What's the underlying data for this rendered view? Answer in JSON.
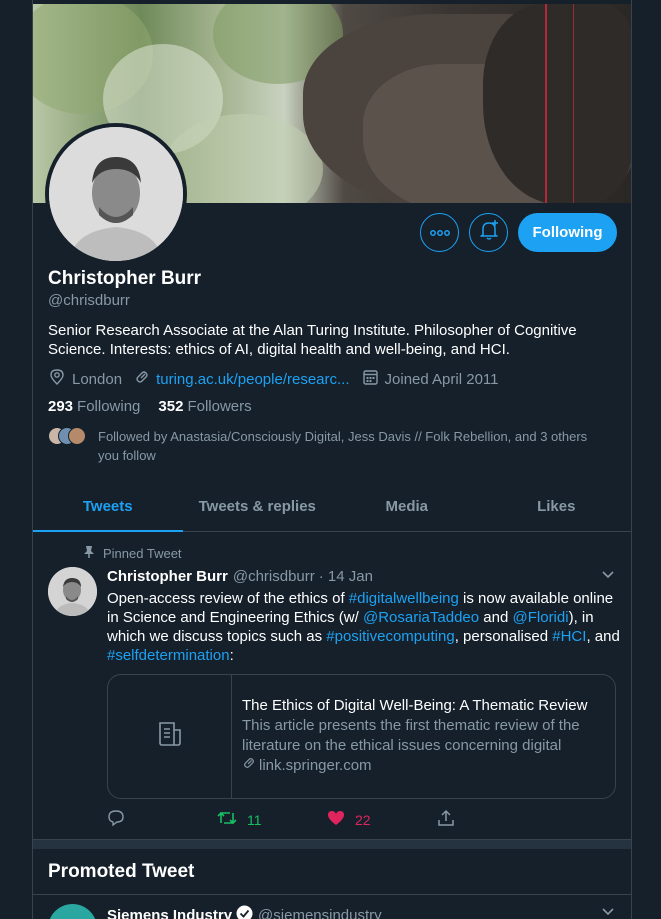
{
  "colors": {
    "background": "#15202b",
    "accent": "#1da1f2",
    "muted": "#8899a6",
    "retweet": "#17bf63",
    "like": "#e0245e",
    "border": "#38444d"
  },
  "profile": {
    "name": "Christopher Burr",
    "handle": "@chrisdburr",
    "bio": "Senior Research Associate at the Alan Turing Institute. Philosopher of Cognitive Science. Interests: ethics of AI, digital health and well-being, and HCI.",
    "location": "London",
    "website": "turing.ac.uk/people/researc...",
    "joined": "Joined April 2011",
    "following_count": "293",
    "following_label": "Following",
    "followers_count": "352",
    "followers_label": "Followers",
    "followed_by": "Followed by Anastasia/Consciously Digital, Jess Davis // Folk Rebellion, and 3 others you follow",
    "follow_button": "Following",
    "icons": {
      "more": "more-icon",
      "notifications": "bell-plus-icon",
      "location": "location-pin-icon",
      "link": "link-icon",
      "calendar": "calendar-icon"
    }
  },
  "tabs": [
    {
      "label": "Tweets",
      "active": true
    },
    {
      "label": "Tweets & replies",
      "active": false
    },
    {
      "label": "Media",
      "active": false
    },
    {
      "label": "Likes",
      "active": false
    }
  ],
  "pinned_tweet": {
    "pinned_label": "Pinned Tweet",
    "author": "Christopher Burr",
    "handle": "@chrisdburr",
    "date": "· 14 Jan",
    "text": {
      "t1": "Open-access review of the ethics of ",
      "tag1": "#digitalwellbeing",
      "t2": " is now available online in Science and Engineering Ethics (w/ ",
      "mention1": "@RosariaTaddeo",
      "t3": " and ",
      "mention2": "@Floridi",
      "t4": "), in which we discuss topics such as ",
      "tag2": "#positivecomputing",
      "t5": ", personalised ",
      "tag3": "#HCI",
      "t6": ", and ",
      "tag4": "#selfdetermination",
      "t7": ":"
    },
    "card": {
      "title": "The Ethics of Digital Well-Being: A Thematic Review",
      "description": "This article presents the first thematic review of the literature on the ethical issues concerning digital well-...",
      "domain": "link.springer.com"
    },
    "retweets": "11",
    "likes": "22"
  },
  "promoted": {
    "section_title": "Promoted Tweet",
    "author": "Siemens Industry",
    "handle": "@siemensindustry"
  }
}
